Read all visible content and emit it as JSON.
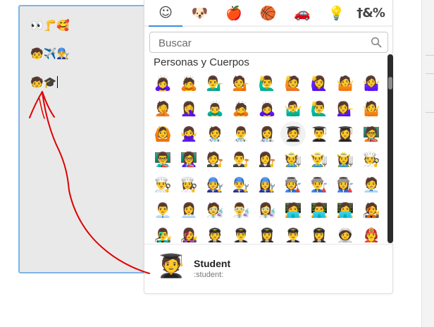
{
  "text_lines": [
    "👀🦵🥰",
    "🧒✈️👨‍🔧",
    "🧒🎓"
  ],
  "picker": {
    "category_tabs": [
      {
        "name": "smiley-face-icon",
        "glyph": "☺"
      },
      {
        "name": "dog-face-icon",
        "glyph": "🐶"
      },
      {
        "name": "apple-icon",
        "glyph": "🍎"
      },
      {
        "name": "basketball-icon",
        "glyph": "🏀"
      },
      {
        "name": "car-icon",
        "glyph": "🚗"
      },
      {
        "name": "lightbulb-icon",
        "glyph": "💡"
      },
      {
        "name": "symbols-icon",
        "glyph": "†&%"
      }
    ],
    "search_placeholder": "Buscar",
    "category_title": "Personas y Cuerpos",
    "emoji_rows": [
      [
        "🙇‍♀️",
        "🙇",
        "💁‍♂️",
        "💁",
        "🙋‍♂️",
        "🙋",
        "🙋‍♀️",
        "🤷",
        "🤷‍♀️"
      ],
      [
        "🤦",
        "🤦‍♀️",
        "🙇‍♂️",
        "🙇",
        "🙇‍♀️",
        "🤷‍♂️",
        "🙋‍♂️",
        "💁‍♀️",
        "🤷"
      ],
      [
        "🙆",
        "🙅‍♀️",
        "🧑‍⚕️",
        "👨‍⚕️",
        "👩‍⚕️",
        "🧑‍🎓",
        "👨‍🎓",
        "👩‍🎓",
        "🧑‍🏫"
      ],
      [
        "👨‍🏫",
        "👩‍🏫",
        "🧑‍⚖️",
        "👨‍⚖️",
        "👩‍⚖️",
        "🧑‍🌾",
        "👨‍🌾",
        "👩‍🌾",
        "🧑‍🍳"
      ],
      [
        "👨‍🍳",
        "👩‍🍳",
        "🧑‍🔧",
        "👨‍🔧",
        "👩‍🔧",
        "🧑‍🏭",
        "👨‍🏭",
        "👩‍🏭",
        "🧑‍💼"
      ],
      [
        "👨‍💼",
        "👩‍💼",
        "🧑‍🔬",
        "👨‍🔬",
        "👩‍🔬",
        "🧑‍💻",
        "👨‍💻",
        "👩‍💻",
        "🧑‍🎤"
      ],
      [
        "👨‍🎤",
        "👩‍🎤",
        "🧑‍✈️",
        "👨‍✈️",
        "👩‍✈️",
        "👨‍✈️",
        "👩‍✈️",
        "🧑‍🚀",
        "🧑‍🚒"
      ]
    ],
    "preview": {
      "emoji": "🧑‍🎓",
      "name": "Student",
      "shortcode": ":student:"
    }
  },
  "colors": {
    "textbox_border": "#7fb3e6",
    "active_tab": "#3b8de0",
    "annotation": "#e00000"
  }
}
